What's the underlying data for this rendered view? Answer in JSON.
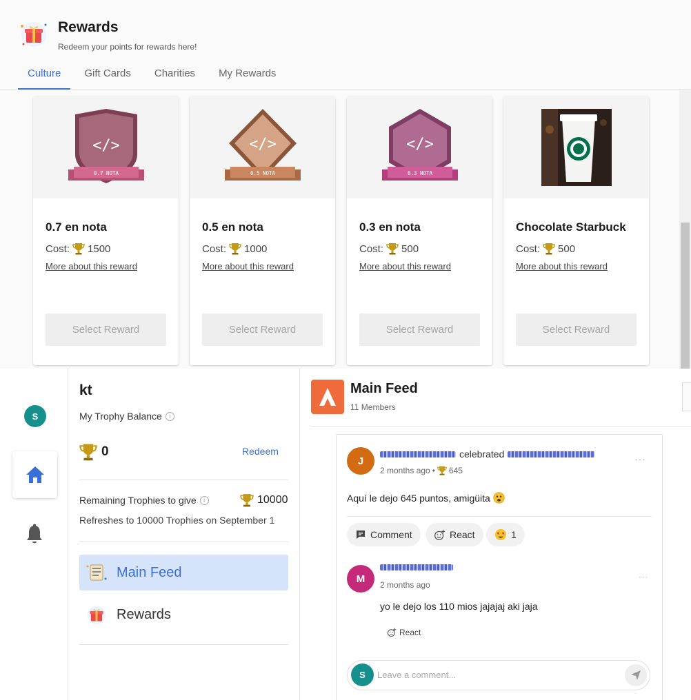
{
  "rewards_header": {
    "title": "Rewards",
    "subtitle": "Redeem your points for rewards here!",
    "icon": "gift-icon"
  },
  "tabs": [
    {
      "label": "Culture",
      "active": true
    },
    {
      "label": "Gift Cards",
      "active": false
    },
    {
      "label": "Charities",
      "active": false
    },
    {
      "label": "My Rewards",
      "active": false
    }
  ],
  "rewards": [
    {
      "badge": "0.7 NOTA",
      "badge_code": "</>",
      "shape": "shield",
      "color": "#9b4f66",
      "ribbon": "#c45c7e",
      "name": "0.7 en nota",
      "cost_label": "Cost:",
      "cost": "1500",
      "more": "More about this reward",
      "button": "Select Reward"
    },
    {
      "badge": "0.5 NOTA",
      "badge_code": "</>",
      "shape": "diamond",
      "color": "#c99174",
      "ribbon": "#c57f58",
      "name": "0.5 en nota",
      "cost_label": "Cost:",
      "cost": "1000",
      "more": "More about this reward",
      "button": "Select Reward"
    },
    {
      "badge": "0.3 NOTA",
      "badge_code": "</>",
      "shape": "hexagon",
      "color": "#a65c86",
      "ribbon": "#c4568f",
      "name": "0.3 en nota",
      "cost_label": "Cost:",
      "cost": "500",
      "more": "More about this reward",
      "button": "Select Reward"
    },
    {
      "badge": "",
      "badge_code": "",
      "shape": "photo",
      "color": "#2b2b2b",
      "ribbon": "#00704a",
      "name": "Chocolate Starbuck",
      "cost_label": "Cost:",
      "cost": "500",
      "more": "More about this reward",
      "button": "Select Reward"
    }
  ],
  "rail": {
    "avatar_letter": "S",
    "avatar_color": "#16908c"
  },
  "profile": {
    "name": "kt",
    "balance_label": "My Trophy Balance",
    "balance": "0",
    "redeem": "Redeem",
    "remaining_label": "Remaining Trophies to give",
    "remaining": "10000",
    "refresh_note": "Refreshes to 10000 Trophies on September 1"
  },
  "nav": [
    {
      "label": "Main Feed",
      "icon": "feed-icon",
      "active": true
    },
    {
      "label": "Rewards",
      "icon": "gift-icon",
      "active": false
    }
  ],
  "feed": {
    "title": "Main Feed",
    "members": "11 Members",
    "accent": "#f06b3c"
  },
  "post": {
    "avatar_letter": "J",
    "avatar_color": "#d26b12",
    "verb": "celebrated",
    "time": "2 months ago",
    "separator": "•",
    "points": "645",
    "text": "Aquí le dejo 645 puntos, amigüita",
    "comment_label": "Comment",
    "react_label": "React",
    "reaction_count": "1"
  },
  "reply": {
    "avatar_letter": "M",
    "avatar_color": "#c4297a",
    "time": "2 months ago",
    "text": "yo le dejo los 110 mios jajajaj aki jaja",
    "react_label": "React"
  },
  "comment_box": {
    "avatar_letter": "S",
    "avatar_color": "#16908c",
    "placeholder": "Leave a comment..."
  }
}
